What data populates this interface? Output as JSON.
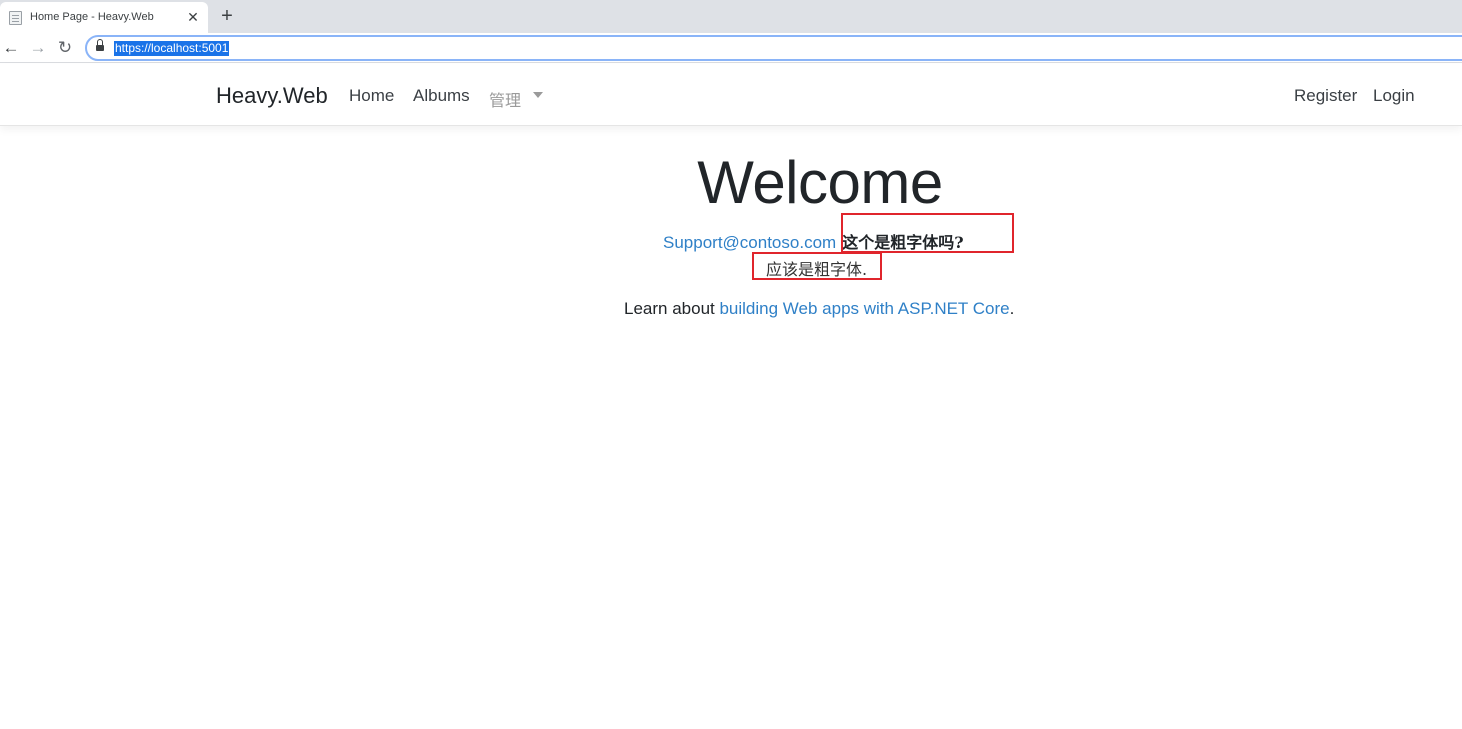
{
  "browser": {
    "tab_title": "Home Page - Heavy.Web",
    "close_symbol": "✕",
    "newtab_symbol": "+",
    "back_symbol": "←",
    "forward_symbol": "→",
    "reload_symbol": "↻",
    "url": "https://localhost:5001"
  },
  "navbar": {
    "brand": "Heavy.Web",
    "links": [
      "Home",
      "Albums",
      "管理"
    ],
    "right_links": [
      "Register",
      "Login"
    ]
  },
  "main": {
    "heading": "Welcome",
    "email": "Support@contoso.com",
    "bold_question": "这个是粗字体吗?",
    "answer": "应该是粗字体.",
    "learn_prefix": "Learn about ",
    "learn_link": "building Web apps with ASP.NET Core",
    "learn_suffix": "."
  },
  "colors": {
    "link": "#2f80c7",
    "highlight_box": "#e0252c",
    "url_selection": "#1a73e8"
  },
  "icons": [
    "page-favicon-icon",
    "close-icon",
    "plus-icon",
    "back-arrow-icon",
    "forward-arrow-icon",
    "reload-icon",
    "lock-icon",
    "caret-down-icon"
  ]
}
